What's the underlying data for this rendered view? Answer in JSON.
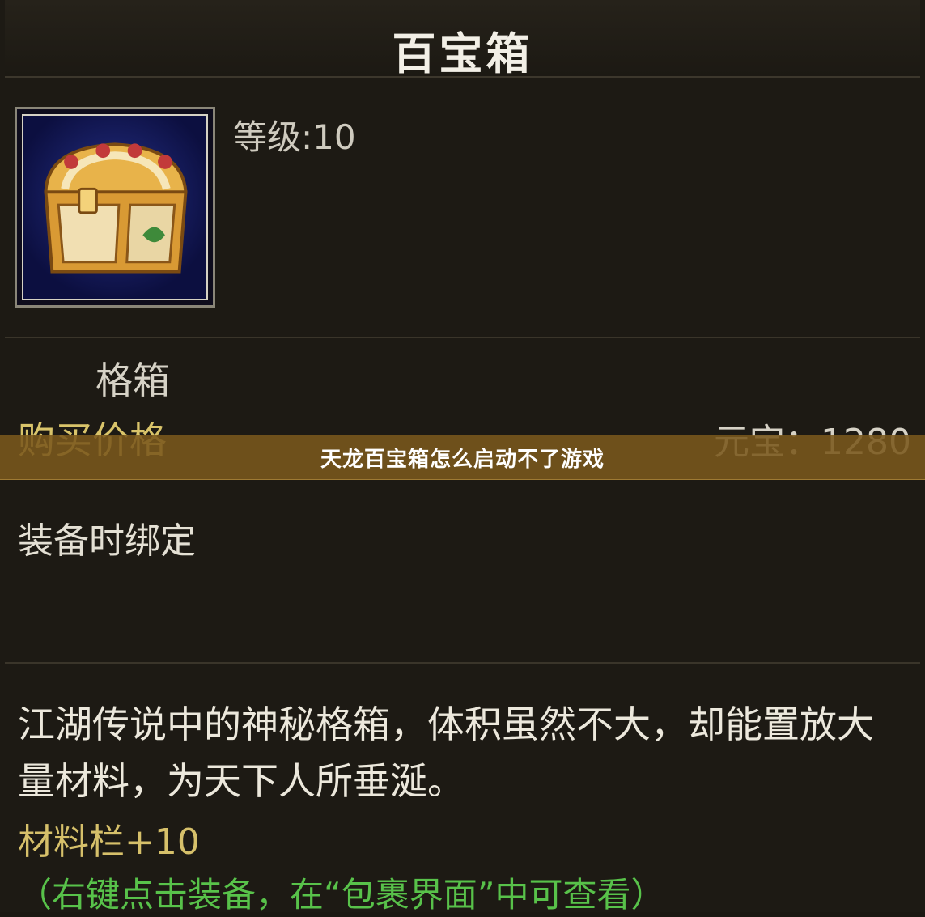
{
  "window": {
    "title": "百宝箱"
  },
  "item": {
    "icon": "treasure-chest-icon",
    "level_label": "等级",
    "level_separator": ":",
    "level_value": "10"
  },
  "info": {
    "category": "格箱",
    "price_label": "购买价格",
    "price_currency": "元宝：",
    "price_value": "1280",
    "bind": "装备时绑定"
  },
  "banner": {
    "text": "天龙百宝箱怎么启动不了游戏"
  },
  "description": {
    "text": "江湖传说中的神秘格箱，体积虽然不大，却能置放大量材料，为天下人所垂涎。",
    "bonus": "材料栏+10",
    "hint": "（右键点击装备，在“包裹界面”中可查看）"
  },
  "colors": {
    "gold": "#d9c46a",
    "green": "#58c24a",
    "banner": "#7a581c"
  }
}
